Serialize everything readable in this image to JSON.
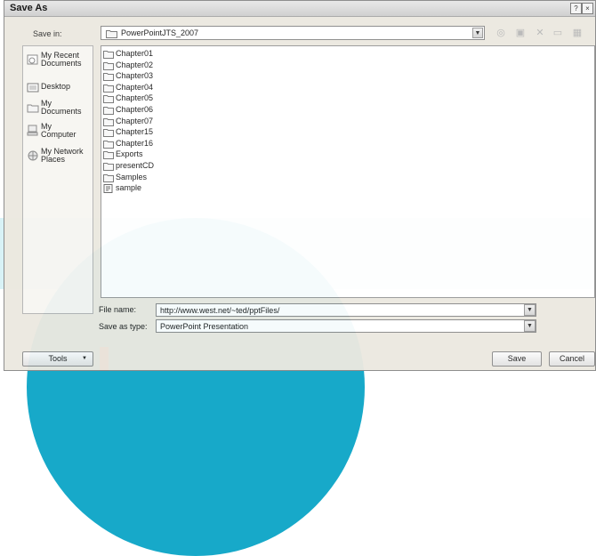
{
  "window": {
    "title": "Save As",
    "help_glyph": "?",
    "close_glyph": "×"
  },
  "save_in": {
    "label": "Save in:",
    "value": "PowerPointJTS_2007",
    "dropdown_glyph": "▼"
  },
  "toolbar": {
    "icons": [
      "web-icon",
      "up-folder-icon",
      "delete-icon",
      "new-folder-icon",
      "views-icon"
    ]
  },
  "places": [
    {
      "label_line1": "My Recent",
      "label_line2": "Documents",
      "icon": "recent-docs-icon"
    },
    {
      "label_line1": "Desktop",
      "label_line2": "",
      "icon": "desktop-icon"
    },
    {
      "label_line1": "My",
      "label_line2": "Documents",
      "icon": "my-documents-icon"
    },
    {
      "label_line1": "My",
      "label_line2": "Computer",
      "icon": "my-computer-icon"
    },
    {
      "label_line1": "My Network",
      "label_line2": "Places",
      "icon": "network-places-icon"
    }
  ],
  "files": [
    {
      "name": "Chapter01",
      "type": "folder"
    },
    {
      "name": "Chapter02",
      "type": "folder"
    },
    {
      "name": "Chapter03",
      "type": "folder"
    },
    {
      "name": "Chapter04",
      "type": "folder"
    },
    {
      "name": "Chapter05",
      "type": "folder"
    },
    {
      "name": "Chapter06",
      "type": "folder"
    },
    {
      "name": "Chapter07",
      "type": "folder"
    },
    {
      "name": "Chapter15",
      "type": "folder"
    },
    {
      "name": "Chapter16",
      "type": "folder"
    },
    {
      "name": "Exports",
      "type": "folder"
    },
    {
      "name": "presentCD",
      "type": "folder"
    },
    {
      "name": "Samples",
      "type": "folder"
    },
    {
      "name": "sample",
      "type": "presentation"
    }
  ],
  "file_name": {
    "label": "File name:",
    "value": "http://www.west.net/~ted/pptFiles/"
  },
  "save_as_type": {
    "label": "Save as type:",
    "value": "PowerPoint Presentation"
  },
  "buttons": {
    "tools": "Tools",
    "tools_arrow": "▼",
    "save": "Save",
    "cancel": "Cancel"
  },
  "colors": {
    "dialog_bg": "#ece9e0",
    "watermark": "#17a9c9",
    "folder": "#e8c96a"
  }
}
